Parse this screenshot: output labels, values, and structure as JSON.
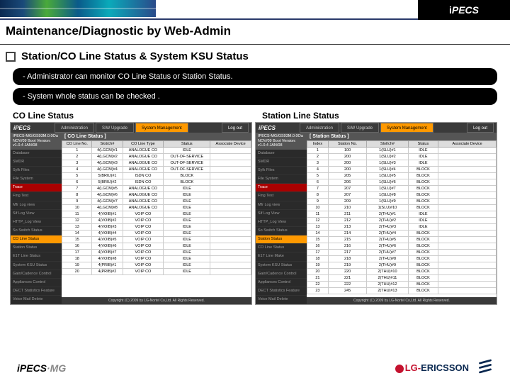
{
  "brand": "iPECS",
  "title": "Maintenance/Diagnostic by Web-Admin",
  "subtitle": "Station/CO Line Status & System KSU Status",
  "info1": "- Administrator can monitor CO Line Status or Station Status.",
  "info2": "- System whole status can be checked .",
  "left_label": "CO Line Status",
  "right_label": "Station Line Status",
  "tabs": {
    "adm": "Administration",
    "sw": "S/W Upgrade",
    "sys": "System Management",
    "lo": "Log out"
  },
  "nav_hdr": "IPECS-MG/GS93M.0.0Oa NOV/09\nBoot Version: v1.0.4 JAN/08",
  "nav": [
    "Database",
    "SMDR",
    "Sylk Files",
    "File System"
  ],
  "nav_trace": "Trace",
  "nav_sub": [
    "Fing Test",
    "Mfr Log view",
    "Sif Log View",
    "HTTP_Log View",
    "So Switch Status"
  ],
  "nav_sel_left": "CO Line Status",
  "nav_sel_right": "Station Status",
  "nav2": [
    "Station Status",
    "E1T Line Status",
    "System KSU Status",
    "Gain/Cadence Control",
    "Appliances Control",
    "DECT Statistics Feature",
    "Voice Mail Delete"
  ],
  "nav2r": [
    "CO Line Status",
    "E1T Line Make",
    "System KSU Status",
    "Gain/Cadence Control",
    "Appliances Control",
    "DECT Statistics Feature",
    "Voice Mail Delete"
  ],
  "main_hdr_left": "[ CO Line Status ]",
  "main_hdr_right": "[ Station Status ]",
  "co_headers": [
    "CO Line No.",
    "Slot/ch#",
    "CO Line Type",
    "Status",
    "Associate Device"
  ],
  "co_rows": [
    [
      "1",
      "4(LGCM)#1",
      "ANALOGUE CO",
      "IDLE",
      ""
    ],
    [
      "2",
      "4(LGCM)#2",
      "ANALOGUE CO",
      "OUT-OF-SERVICE",
      ""
    ],
    [
      "3",
      "4(LGCM)#3",
      "ANALOGUE CO",
      "OUT-OF-SERVICE",
      ""
    ],
    [
      "4",
      "4(LGCM)#4",
      "ANALOGUE CO",
      "OUT-OF-SERVICE",
      ""
    ],
    [
      "5",
      "5(BRIU)#1",
      "ISDN CO",
      "BLOCK",
      ""
    ],
    [
      "6",
      "5(BRIU)#2",
      "ISDN CO",
      "BLOCK",
      ""
    ],
    [
      "7",
      "4(LGCM)#5",
      "ANALOGUE CO",
      "IDLE",
      ""
    ],
    [
      "8",
      "4(LGCM)#6",
      "ANALOGUE CO",
      "IDLE",
      ""
    ],
    [
      "9",
      "4(LGCM)#7",
      "ANALOGUE CO",
      "IDLE",
      ""
    ],
    [
      "10",
      "4(LGCM)#8",
      "ANALOGUE CO",
      "IDLE",
      ""
    ],
    [
      "11",
      "4(VOIB)#1",
      "VOIP CO",
      "IDLE",
      ""
    ],
    [
      "12",
      "4(VOIB)#2",
      "VOIP CO",
      "IDLE",
      ""
    ],
    [
      "13",
      "4(VOIB)#3",
      "VOIP CO",
      "IDLE",
      ""
    ],
    [
      "14",
      "4(VOIB)#4",
      "VOIP CO",
      "IDLE",
      ""
    ],
    [
      "15",
      "4(VOIB)#5",
      "VOIP CO",
      "IDLE",
      ""
    ],
    [
      "16",
      "4(VOIB)#6",
      "VOIP CO",
      "IDLE",
      ""
    ],
    [
      "17",
      "4(VOIB)#7",
      "VOIP CO",
      "IDLE",
      ""
    ],
    [
      "18",
      "4(VOIB)#8",
      "VOIP CO",
      "IDLE",
      ""
    ],
    [
      "19",
      "4(PRIB)#1",
      "VOIP CO",
      "IDLE",
      ""
    ],
    [
      "20",
      "4(PRIB)#2",
      "VOIP CO",
      "IDLE",
      ""
    ]
  ],
  "sta_headers": [
    "Index",
    "Station No.",
    "Slot/ch#",
    "Status",
    "Associate Device"
  ],
  "sta_rows": [
    [
      "1",
      "100",
      "1(SLU)#1",
      "IDLE",
      ""
    ],
    [
      "2",
      "200",
      "1(SLU)#2",
      "IDLE",
      ""
    ],
    [
      "3",
      "200",
      "1(SLU)#3",
      "IDLE",
      ""
    ],
    [
      "4",
      "200",
      "1(SLU)#4",
      "BLOCK",
      ""
    ],
    [
      "5",
      "205",
      "1(SLU)#5",
      "BLOCK",
      ""
    ],
    [
      "6",
      "206",
      "1(SLU)#6",
      "BLOCK",
      ""
    ],
    [
      "7",
      "207",
      "1(SLU)#7",
      "BLOCK",
      ""
    ],
    [
      "8",
      "207",
      "1(SLU)#8",
      "BLOCK",
      ""
    ],
    [
      "9",
      "209",
      "1(SLU)#9",
      "BLOCK",
      ""
    ],
    [
      "10",
      "210",
      "1(SLU)#10",
      "BLOCK",
      ""
    ],
    [
      "11",
      "211",
      "2(THU)#1",
      "IDLE",
      ""
    ],
    [
      "12",
      "212",
      "2(THU)#2",
      "IDLE",
      ""
    ],
    [
      "13",
      "213",
      "2(THU)#3",
      "IDLE",
      ""
    ],
    [
      "14",
      "214",
      "2(THU)#4",
      "BLOCK",
      ""
    ],
    [
      "15",
      "215",
      "2(THU)#5",
      "BLOCK",
      ""
    ],
    [
      "16",
      "216",
      "2(THU)#6",
      "BLOCK",
      ""
    ],
    [
      "17",
      "217",
      "2(THU)#7",
      "BLOCK",
      ""
    ],
    [
      "18",
      "218",
      "2(THU)#8",
      "BLOCK",
      ""
    ],
    [
      "19",
      "219",
      "2(THU)#9",
      "BLOCK",
      ""
    ],
    [
      "20",
      "220",
      "2(THU)#10",
      "BLOCK",
      ""
    ],
    [
      "21",
      "221",
      "2(THU)#11",
      "BLOCK",
      ""
    ],
    [
      "22",
      "222",
      "2(THU)#12",
      "BLOCK",
      ""
    ],
    [
      "23",
      "245",
      "2(THU)#13",
      "BLOCK",
      ""
    ]
  ],
  "copyright": "Copyright (C) 2009 by LG-Nortel Co,Ltd. All Rights Reserved.",
  "footer_brand": "iPECS",
  "footer_mg": "·MG",
  "lg_l": "LG-",
  "lg_e": "ERICSSON"
}
